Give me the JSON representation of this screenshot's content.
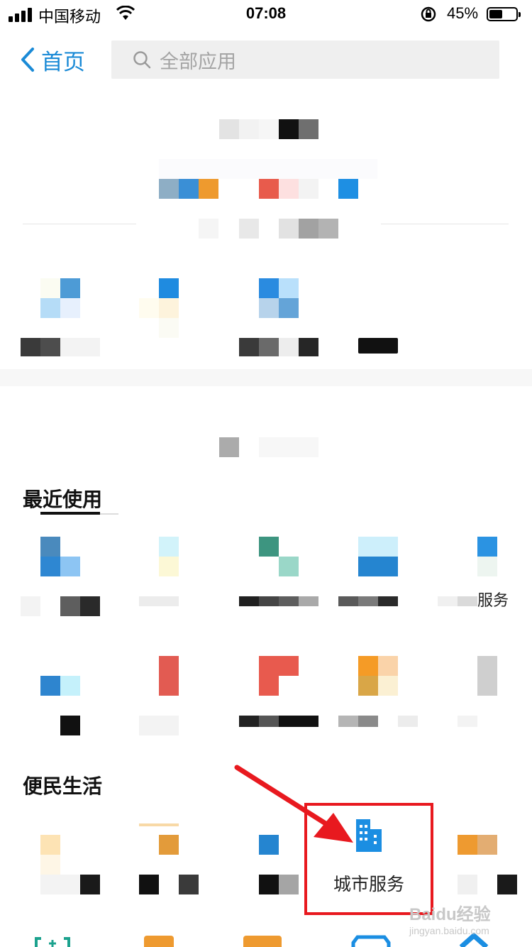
{
  "status_bar": {
    "carrier": "中国移动",
    "time": "07:08",
    "battery": "45%",
    "battery_level": 0.45
  },
  "nav": {
    "back_label": "首页",
    "search_placeholder": "全部应用"
  },
  "sections": {
    "recent_title": "最近使用",
    "convenience_title": "便民生活"
  },
  "apps": {
    "partial_fuwu": "服务",
    "city_service": "城市服务"
  },
  "colors": {
    "accent": "#1a8ad6",
    "highlight": "#e8191f"
  },
  "icons": [
    "search-icon",
    "chevron-left-icon",
    "city-building-icon",
    "wifi-icon",
    "rotation-lock-icon"
  ],
  "watermark": {
    "brand": "Baidu经验",
    "url": "jingyan.baidu.com"
  }
}
